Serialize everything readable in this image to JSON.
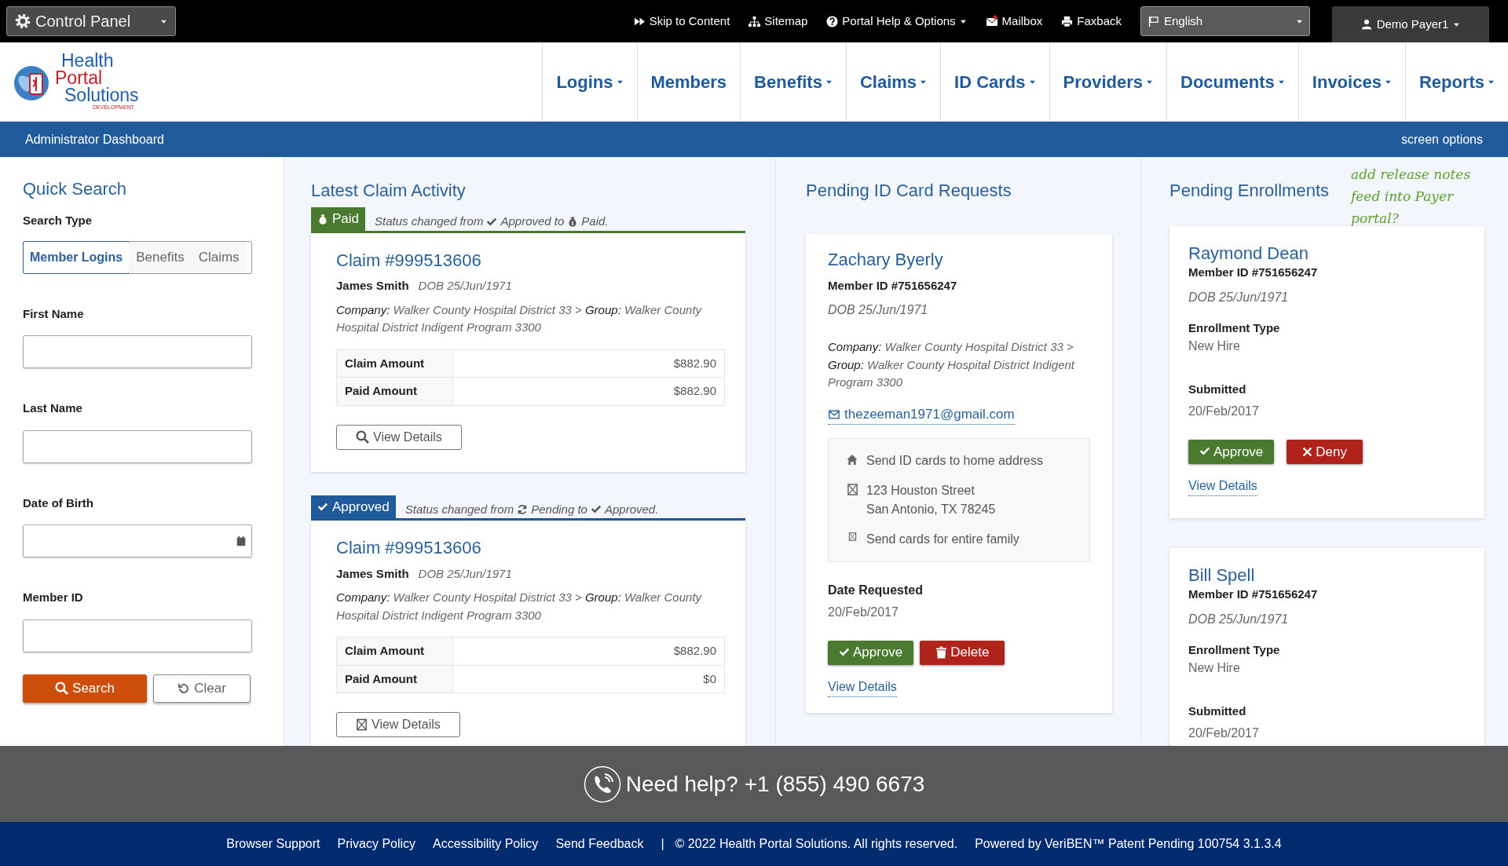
{
  "top_bar": {
    "control_panel": "Control Panel",
    "links": [
      {
        "label": "Skip to Content",
        "kind": "skip",
        "dropdown": false
      },
      {
        "label": "Sitemap",
        "kind": "sitemap",
        "dropdown": false
      },
      {
        "label": "Portal Help & Options",
        "kind": "help",
        "dropdown": true
      },
      {
        "label": "Mailbox",
        "kind": "mail",
        "dropdown": false
      },
      {
        "label": "Faxback",
        "kind": "fax",
        "dropdown": false
      }
    ],
    "language": "English",
    "user": "Demo Payer1"
  },
  "logo": {
    "lines": [
      "Health",
      "Portal",
      "Solutions"
    ],
    "tag": "DEVELOPMENT"
  },
  "nav": [
    {
      "label": "Logins",
      "dropdown": true
    },
    {
      "label": "Members",
      "dropdown": false
    },
    {
      "label": "Benefits",
      "dropdown": true
    },
    {
      "label": "Claims",
      "dropdown": true
    },
    {
      "label": "ID Cards",
      "dropdown": true
    },
    {
      "label": "Providers",
      "dropdown": true
    },
    {
      "label": "Documents",
      "dropdown": true
    },
    {
      "label": "Invoices",
      "dropdown": true
    },
    {
      "label": "Reports",
      "dropdown": true
    }
  ],
  "dashboard_bar": {
    "title": "Administrator Dashboard",
    "options": "screen options"
  },
  "quick_search": {
    "title": "Quick Search",
    "type_label": "Search Type",
    "types": [
      {
        "label": "Member Logins",
        "selected": true
      },
      {
        "label": "Benefits",
        "selected": false
      },
      {
        "label": "Claims",
        "selected": false
      }
    ],
    "fields": [
      {
        "label": "First Name",
        "kind": "text"
      },
      {
        "label": "Last Name",
        "kind": "text"
      },
      {
        "label": "Date of Birth",
        "kind": "date"
      },
      {
        "label": "Member ID",
        "kind": "text"
      }
    ],
    "search": "Search",
    "clear": "Clear"
  },
  "claims": {
    "title": "Latest Claim Activity",
    "items": [
      {
        "status": "Paid",
        "kind": "paid",
        "note": [
          {
            "kind": "plain",
            "text": "Status changed from"
          },
          {
            "kind": "approved",
            "text": "Approved"
          },
          {
            "kind": "plain",
            "text": "to"
          },
          {
            "kind": "paid",
            "text": "Paid."
          }
        ],
        "claim": "Claim #999513606",
        "name": "James Smith",
        "dob": "DOB 25/Jun/1971",
        "company_label": "Company:",
        "company": "Walker County Hospital District 33 >",
        "group_label": "Group:",
        "group": "Walker County Hospital  District Indigent Program 3300",
        "amounts": [
          {
            "label": "Claim Amount",
            "value": "$882.90"
          },
          {
            "label": "Paid Amount",
            "value": "$882.90"
          }
        ],
        "buttons": [
          {
            "label": "View Details",
            "kind": "search"
          }
        ]
      },
      {
        "status": "Approved",
        "kind": "approved",
        "note": [
          {
            "kind": "plain",
            "text": "Status changed from"
          },
          {
            "kind": "pending",
            "text": "Pending"
          },
          {
            "kind": "plain",
            "text": "to"
          },
          {
            "kind": "approved",
            "text": "Approved."
          }
        ],
        "claim": "Claim #999513606",
        "name": "James Smith",
        "dob": "DOB 25/Jun/1971",
        "company_label": "Company:",
        "company": "Walker County Hospital District 33 >",
        "group_label": "Group:",
        "group": "Walker County Hospital  District Indigent Program 3300",
        "amounts": [
          {
            "label": "Claim Amount",
            "value": "$882.90"
          },
          {
            "label": "Paid Amount",
            "value": "$0"
          }
        ],
        "buttons": [
          {
            "label": "View Details",
            "kind": "box"
          }
        ]
      }
    ]
  },
  "id_requests": {
    "title": "Pending ID Card Requests",
    "items": [
      {
        "name": "Zachary Byerly",
        "member_id": "Member ID #751656247",
        "dob": "DOB 25/Jun/1971",
        "company_label": "Company:",
        "company": "Walker County Hospital District 33 >",
        "group_label": "Group:",
        "group": "Walker County Hospital  District Indigent Program 3300",
        "email": "thezeeman1971@gmail.com",
        "options": [
          {
            "kind": "home",
            "lines": [
              "Send ID cards to home address"
            ]
          },
          {
            "kind": "box",
            "lines": [
              "123 Houston Street",
              "San Antonio, TX 78245"
            ]
          },
          {
            "kind": "small-box",
            "lines": [
              "Send cards for entire family"
            ]
          }
        ],
        "date_label": "Date Requested",
        "date": "20/Feb/2017",
        "approve": "Approve",
        "delete": "Delete",
        "details": "View Details"
      }
    ]
  },
  "enrollments": {
    "title": "Pending Enrollments",
    "note": "add release notes feed into Payer portal?",
    "items": [
      {
        "name": "Raymond Dean",
        "member_id": "Member ID #751656247",
        "dob": "DOB 25/Jun/1971",
        "type_label": "Enrollment Type",
        "type": "New Hire",
        "submitted_label": "Submitted",
        "submitted": "20/Feb/2017",
        "approve": "Approve",
        "deny": "Deny",
        "details": "View Details"
      },
      {
        "name": "Bill Spell",
        "member_id": "Member ID #751656247",
        "dob": "DOB 25/Jun/1971",
        "type_label": "Enrollment Type",
        "type": "New Hire",
        "submitted_label": "Submitted",
        "submitted": "20/Feb/2017"
      }
    ]
  },
  "help_bar": {
    "text": "Need help? +1 (855) 490 6673"
  },
  "footer": {
    "links": [
      "Browser Support",
      "Privacy Policy",
      "Accessibility Policy",
      "Send Feedback"
    ],
    "separator": "|",
    "copyright": "© 2022 Health Portal Solutions. All rights reserved.",
    "powered": "Powered by VeriBEN™ Patent Pending 100754 3.1.3.4"
  }
}
